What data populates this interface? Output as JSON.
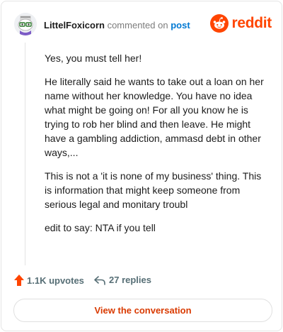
{
  "header": {
    "author": "LittelFoxicorn",
    "action": "commented on",
    "target": "post",
    "brand": "reddit"
  },
  "comment": {
    "paragraphs": [
      "Yes, you must tell her!",
      "He literally said he wants to take out a loan on her name without her knowledge. You have no idea what might be going on! For all you know he is trying to rob her blind and then leave. He might have a gambling addiction, ammasd debt in other ways,...",
      "This is not a 'it is none of my business' thing. This is information that might keep someone from serious legal and monitary troubl",
      "edit to say: NTA if you tell"
    ]
  },
  "footer": {
    "upvotes": "1.1K upvotes",
    "replies": "27 replies",
    "view_label": "View the conversation"
  },
  "colors": {
    "brand": "#ff4500",
    "link": "#0079d3",
    "muted": "#576f76",
    "cta": "#d93a00"
  }
}
